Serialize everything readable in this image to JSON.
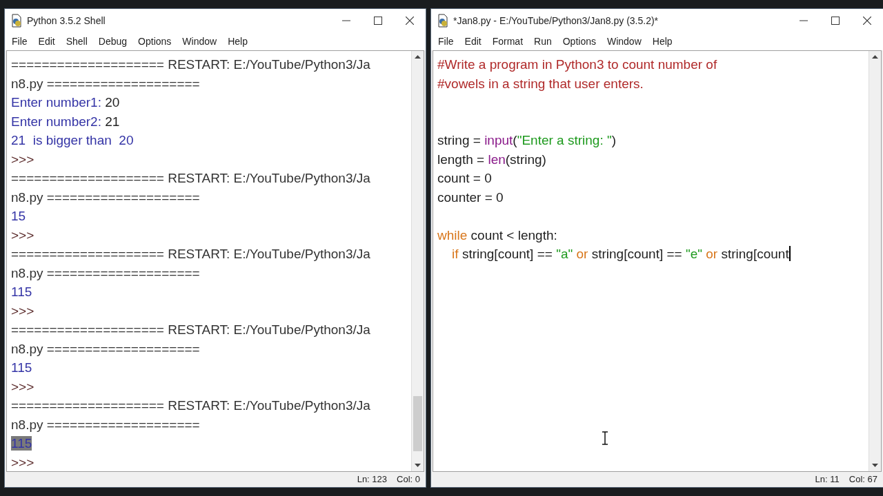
{
  "shell_window": {
    "title": "Python 3.5.2 Shell",
    "menu": [
      "File",
      "Edit",
      "Shell",
      "Debug",
      "Options",
      "Window",
      "Help"
    ],
    "lines": [
      {
        "segments": [
          {
            "text": "==================== RESTART: E:/YouTube/Python3/Ja",
            "kind": "restart",
            "selected": false
          }
        ]
      },
      {
        "segments": [
          {
            "text": "n8.py ====================",
            "kind": "restart",
            "selected": false
          }
        ]
      },
      {
        "segments": [
          {
            "text": "Enter number1: ",
            "kind": "stdout",
            "selected": false
          },
          {
            "text": "20",
            "kind": "input",
            "selected": false
          }
        ]
      },
      {
        "segments": [
          {
            "text": "Enter number2: ",
            "kind": "stdout",
            "selected": false
          },
          {
            "text": "21",
            "kind": "input",
            "selected": false
          }
        ]
      },
      {
        "segments": [
          {
            "text": "21  is bigger than  20",
            "kind": "stdout",
            "selected": false
          }
        ]
      },
      {
        "segments": [
          {
            "text": ">>>",
            "kind": "prompt",
            "selected": false
          }
        ]
      },
      {
        "segments": [
          {
            "text": "==================== RESTART: E:/YouTube/Python3/Ja",
            "kind": "restart",
            "selected": false
          }
        ]
      },
      {
        "segments": [
          {
            "text": "n8.py ====================",
            "kind": "restart",
            "selected": false
          }
        ]
      },
      {
        "segments": [
          {
            "text": "15",
            "kind": "stdout",
            "selected": false
          }
        ]
      },
      {
        "segments": [
          {
            "text": ">>>",
            "kind": "prompt",
            "selected": false
          }
        ]
      },
      {
        "segments": [
          {
            "text": "==================== RESTART: E:/YouTube/Python3/Ja",
            "kind": "restart",
            "selected": false
          }
        ]
      },
      {
        "segments": [
          {
            "text": "n8.py ====================",
            "kind": "restart",
            "selected": false
          }
        ]
      },
      {
        "segments": [
          {
            "text": "115",
            "kind": "stdout",
            "selected": false
          }
        ]
      },
      {
        "segments": [
          {
            "text": ">>>",
            "kind": "prompt",
            "selected": false
          }
        ]
      },
      {
        "segments": [
          {
            "text": "==================== RESTART: E:/YouTube/Python3/Ja",
            "kind": "restart",
            "selected": false
          }
        ]
      },
      {
        "segments": [
          {
            "text": "n8.py ====================",
            "kind": "restart",
            "selected": false
          }
        ]
      },
      {
        "segments": [
          {
            "text": "115",
            "kind": "stdout",
            "selected": false
          }
        ]
      },
      {
        "segments": [
          {
            "text": ">>>",
            "kind": "prompt",
            "selected": false
          }
        ]
      },
      {
        "segments": [
          {
            "text": "==================== RESTART: E:/YouTube/Python3/Ja",
            "kind": "restart",
            "selected": false
          }
        ]
      },
      {
        "segments": [
          {
            "text": "n8.py ====================",
            "kind": "restart",
            "selected": false
          }
        ]
      },
      {
        "segments": [
          {
            "text": "115",
            "kind": "stdout",
            "selected": true
          }
        ]
      },
      {
        "segments": [
          {
            "text": ">>>",
            "kind": "prompt",
            "selected": false
          }
        ]
      }
    ],
    "status": {
      "line": "Ln: 123",
      "column": "Col: 0"
    }
  },
  "editor_window": {
    "title": "*Jan8.py - E:/YouTube/Python3/Jan8.py (3.5.2)*",
    "menu": [
      "File",
      "Edit",
      "Format",
      "Run",
      "Options",
      "Window",
      "Help"
    ],
    "lines": [
      {
        "kind": "code",
        "tokens": [
          {
            "text": "#Write a program in Python3 to count number of",
            "kind": "comment"
          }
        ]
      },
      {
        "kind": "code",
        "tokens": [
          {
            "text": "#vowels in a string that user enters.",
            "kind": "comment"
          }
        ]
      },
      {
        "kind": "blank"
      },
      {
        "kind": "blank"
      },
      {
        "kind": "code",
        "tokens": [
          {
            "text": "string = ",
            "kind": "plain"
          },
          {
            "text": "input",
            "kind": "builtin"
          },
          {
            "text": "(",
            "kind": "plain"
          },
          {
            "text": "\"Enter a string: \"",
            "kind": "string"
          },
          {
            "text": ")",
            "kind": "plain"
          }
        ]
      },
      {
        "kind": "code",
        "tokens": [
          {
            "text": "length = ",
            "kind": "plain"
          },
          {
            "text": "len",
            "kind": "builtin"
          },
          {
            "text": "(string)",
            "kind": "plain"
          }
        ]
      },
      {
        "kind": "code",
        "tokens": [
          {
            "text": "count = 0",
            "kind": "plain"
          }
        ]
      },
      {
        "kind": "code",
        "tokens": [
          {
            "text": "counter = 0",
            "kind": "plain"
          }
        ]
      },
      {
        "kind": "blank"
      },
      {
        "kind": "code",
        "tokens": [
          {
            "text": "while",
            "kind": "keyword"
          },
          {
            "text": " count < length:",
            "kind": "plain"
          }
        ]
      },
      {
        "kind": "code",
        "tokens": [
          {
            "text": "    if",
            "kind": "keyword"
          },
          {
            "text": " string[count] == ",
            "kind": "plain"
          },
          {
            "text": "\"a\"",
            "kind": "string"
          },
          {
            "text": " or",
            "kind": "keyword"
          },
          {
            "text": " string[count] == ",
            "kind": "plain"
          },
          {
            "text": "\"e\"",
            "kind": "string"
          },
          {
            "text": " or",
            "kind": "keyword"
          },
          {
            "text": " string[count",
            "kind": "plain"
          }
        ]
      }
    ],
    "status": {
      "line": "Ln: 11",
      "column": "Col: 67"
    }
  }
}
